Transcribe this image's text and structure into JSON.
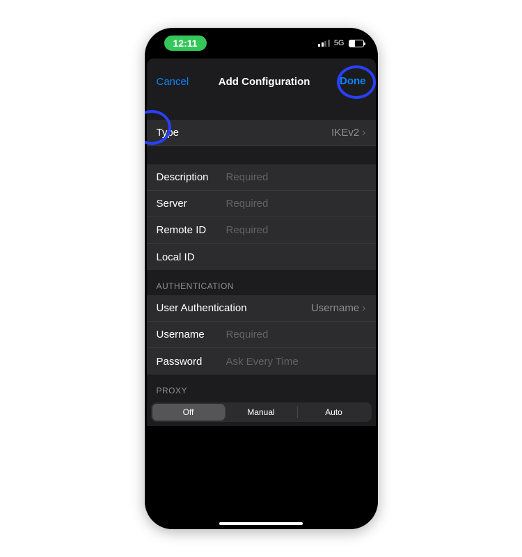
{
  "status": {
    "time": "12:11",
    "network": "5G"
  },
  "nav": {
    "cancel": "Cancel",
    "title": "Add Configuration",
    "done": "Done"
  },
  "type_row": {
    "label": "Type",
    "value": "IKEv2"
  },
  "fields": {
    "description": {
      "label": "Description",
      "placeholder": "Required"
    },
    "server": {
      "label": "Server",
      "placeholder": "Required"
    },
    "remote_id": {
      "label": "Remote ID",
      "placeholder": "Required"
    },
    "local_id": {
      "label": "Local ID",
      "placeholder": ""
    }
  },
  "auth": {
    "header": "AUTHENTICATION",
    "user_auth": {
      "label": "User Authentication",
      "value": "Username"
    },
    "username": {
      "label": "Username",
      "placeholder": "Required"
    },
    "password": {
      "label": "Password",
      "placeholder": "Ask Every Time"
    }
  },
  "proxy": {
    "header": "PROXY",
    "options": [
      "Off",
      "Manual",
      "Auto"
    ],
    "selected": "Off"
  }
}
